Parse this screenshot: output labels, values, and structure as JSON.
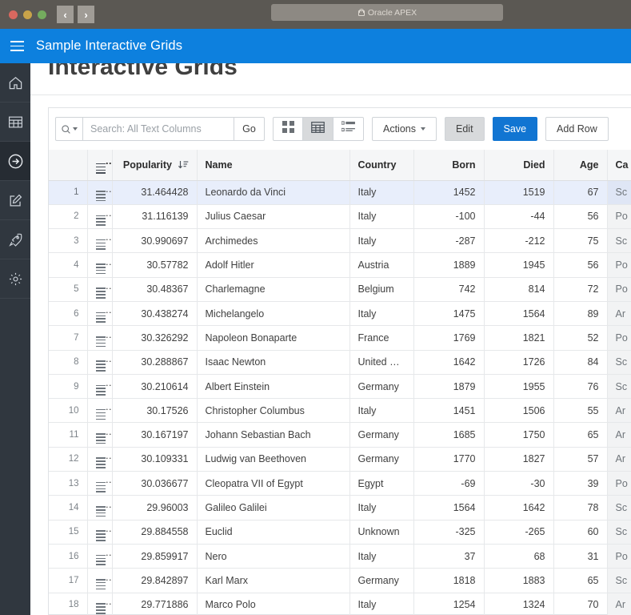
{
  "browser": {
    "url_label": "Oracle APEX",
    "lock_icon": "lock-icon",
    "back_icon": "‹",
    "forward_icon": "›"
  },
  "app_header": {
    "title": "Sample Interactive Grids",
    "menu_icon": "hamburger-menu-icon",
    "background": "#0d80de"
  },
  "sidebar": {
    "items": [
      {
        "icon": "home-icon",
        "active": false
      },
      {
        "icon": "table-icon",
        "active": false
      },
      {
        "icon": "arrow-right-circle-icon",
        "active": true
      },
      {
        "icon": "edit-square-icon",
        "active": false
      },
      {
        "icon": "rocket-icon",
        "active": false
      },
      {
        "icon": "gear-icon",
        "active": false
      }
    ],
    "background": "#30373f"
  },
  "page": {
    "title": "Interactive Grids"
  },
  "toolbar": {
    "search_icon": "search-icon",
    "search_dropdown_icon": "chevron-down-icon",
    "search_placeholder": "Search: All Text Columns",
    "search_value": "",
    "go_label": "Go",
    "views": [
      {
        "name": "icon-view",
        "icon": "grid-squares-icon",
        "selected": false
      },
      {
        "name": "grid-view",
        "icon": "table-grid-icon",
        "selected": true
      },
      {
        "name": "detail-view",
        "icon": "list-detail-icon",
        "selected": false
      }
    ],
    "actions_label": "Actions",
    "actions_caret_icon": "chevron-down-icon",
    "edit_label": "Edit",
    "edit_pressed": true,
    "save_label": "Save",
    "save_color": "#1175d2",
    "add_row_label": "Add Row"
  },
  "grid": {
    "row_actions_icon": "row-actions-menu-icon",
    "sort_icon": "sort-descending-icon",
    "columns": [
      {
        "key": "popularity",
        "label": "Popularity",
        "sorted": "desc"
      },
      {
        "key": "name",
        "label": "Name"
      },
      {
        "key": "country",
        "label": "Country"
      },
      {
        "key": "born",
        "label": "Born"
      },
      {
        "key": "died",
        "label": "Died"
      },
      {
        "key": "age",
        "label": "Age"
      },
      {
        "key": "category",
        "label": "Ca"
      }
    ],
    "rows": [
      {
        "n": "1",
        "popularity": "31.464428",
        "name": "Leonardo da Vinci",
        "country": "Italy",
        "born": "1452",
        "died": "1519",
        "age": "67",
        "category": "Sc"
      },
      {
        "n": "2",
        "popularity": "31.116139",
        "name": "Julius Caesar",
        "country": "Italy",
        "born": "-100",
        "died": "-44",
        "age": "56",
        "category": "Po"
      },
      {
        "n": "3",
        "popularity": "30.990697",
        "name": "Archimedes",
        "country": "Italy",
        "born": "-287",
        "died": "-212",
        "age": "75",
        "category": "Sc"
      },
      {
        "n": "4",
        "popularity": "30.57782",
        "name": "Adolf Hitler",
        "country": "Austria",
        "born": "1889",
        "died": "1945",
        "age": "56",
        "category": "Po"
      },
      {
        "n": "5",
        "popularity": "30.48367",
        "name": "Charlemagne",
        "country": "Belgium",
        "born": "742",
        "died": "814",
        "age": "72",
        "category": "Po"
      },
      {
        "n": "6",
        "popularity": "30.438274",
        "name": "Michelangelo",
        "country": "Italy",
        "born": "1475",
        "died": "1564",
        "age": "89",
        "category": "Ar"
      },
      {
        "n": "7",
        "popularity": "30.326292",
        "name": "Napoleon Bonaparte",
        "country": "France",
        "born": "1769",
        "died": "1821",
        "age": "52",
        "category": "Po"
      },
      {
        "n": "8",
        "popularity": "30.288867",
        "name": "Isaac Newton",
        "country": "United Kin…",
        "born": "1642",
        "died": "1726",
        "age": "84",
        "category": "Sc"
      },
      {
        "n": "9",
        "popularity": "30.210614",
        "name": "Albert Einstein",
        "country": "Germany",
        "born": "1879",
        "died": "1955",
        "age": "76",
        "category": "Sc"
      },
      {
        "n": "10",
        "popularity": "30.17526",
        "name": "Christopher Columbus",
        "country": "Italy",
        "born": "1451",
        "died": "1506",
        "age": "55",
        "category": "Ar"
      },
      {
        "n": "11",
        "popularity": "30.167197",
        "name": "Johann Sebastian Bach",
        "country": "Germany",
        "born": "1685",
        "died": "1750",
        "age": "65",
        "category": "Ar"
      },
      {
        "n": "12",
        "popularity": "30.109331",
        "name": "Ludwig van Beethoven",
        "country": "Germany",
        "born": "1770",
        "died": "1827",
        "age": "57",
        "category": "Ar"
      },
      {
        "n": "13",
        "popularity": "30.036677",
        "name": "Cleopatra VII of Egypt",
        "country": "Egypt",
        "born": "-69",
        "died": "-30",
        "age": "39",
        "category": "Po"
      },
      {
        "n": "14",
        "popularity": "29.96003",
        "name": "Galileo Galilei",
        "country": "Italy",
        "born": "1564",
        "died": "1642",
        "age": "78",
        "category": "Sc"
      },
      {
        "n": "15",
        "popularity": "29.884558",
        "name": "Euclid",
        "country": "Unknown",
        "born": "-325",
        "died": "-265",
        "age": "60",
        "category": "Sc"
      },
      {
        "n": "16",
        "popularity": "29.859917",
        "name": "Nero",
        "country": "Italy",
        "born": "37",
        "died": "68",
        "age": "31",
        "category": "Po"
      },
      {
        "n": "17",
        "popularity": "29.842897",
        "name": "Karl Marx",
        "country": "Germany",
        "born": "1818",
        "died": "1883",
        "age": "65",
        "category": "Sc"
      },
      {
        "n": "18",
        "popularity": "29.771886",
        "name": "Marco Polo",
        "country": "Italy",
        "born": "1254",
        "died": "1324",
        "age": "70",
        "category": "Ar"
      }
    ]
  }
}
